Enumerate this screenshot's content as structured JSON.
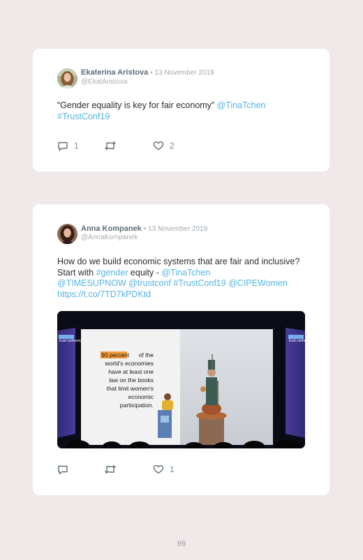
{
  "tweets": [
    {
      "name": "Ekaterina Aristova",
      "date": "• 13 November 2019",
      "handle": "@EkatAristova",
      "body": [
        {
          "text": "“Gender equality is key for fair economy” ",
          "link": false
        },
        {
          "text": "@TinaTchen",
          "link": true
        },
        {
          "text": " ",
          "link": false
        },
        {
          "text": "#TrustConf19",
          "link": true
        }
      ],
      "actions": {
        "reply": "1",
        "retweet": "",
        "like": "2"
      }
    },
    {
      "name": "Anna Kompanek",
      "date": "• 13 November 2019",
      "handle": "@AnnaKompanek",
      "body": [
        {
          "text": "How do we build economic systems that are fair and inclusive? Start with ",
          "link": false
        },
        {
          "text": "#gender",
          "link": true
        },
        {
          "text": " equity - ",
          "link": false
        },
        {
          "text": "@TinaTchen",
          "link": true
        },
        {
          "text": " ",
          "link": false
        },
        {
          "text": "@TIMESUPNOW",
          "link": true
        },
        {
          "text": " ",
          "link": false
        },
        {
          "text": "@trustconf",
          "link": true
        },
        {
          "text": " ",
          "link": false
        },
        {
          "text": "#TrustConf19",
          "link": true
        },
        {
          "text": " ",
          "link": false
        },
        {
          "text": "@CIPEWomen",
          "link": true
        },
        {
          "text": " ",
          "link": false
        },
        {
          "text": "https://t.co/7TD7kPDKtd",
          "link": true
        }
      ],
      "actions": {
        "reply": "",
        "retweet": "",
        "like": "1"
      },
      "photo": {
        "slide_highlight": "90 percent",
        "slide_text": "of the world's economies have at least one law on the books that limit women's economic participation.",
        "banner_text": "trust conference",
        "lectern_text": "tc"
      }
    }
  ],
  "page_number": "99",
  "colors": {
    "background": "#f1e8e9",
    "card": "#ffffff",
    "link": "#56b3e6",
    "highlight": "#f29a3a"
  }
}
